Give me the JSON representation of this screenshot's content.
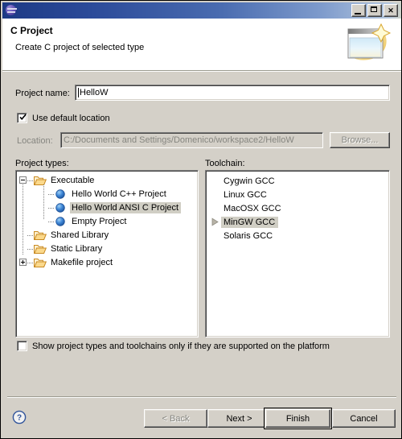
{
  "window": {
    "title": "",
    "app_icon": "eclipse-icon",
    "controls": {
      "minimize": "minimize-button",
      "maximize": "maximize-button",
      "close_label": "✕"
    }
  },
  "header": {
    "title": "C Project",
    "subtitle": "Create C project of selected type",
    "banner_icon": "new-c-project-wizard-icon"
  },
  "form": {
    "project_name_label": "Project name:",
    "project_name_value": "HelloW",
    "use_default_location_label": "Use default location",
    "use_default_location_checked": true,
    "location_label": "Location:",
    "location_value": "C:/Documents and Settings/Domenico/workspace2/HelloW",
    "location_disabled": true,
    "browse_label": "Browse...",
    "browse_disabled": true
  },
  "project_types": {
    "label": "Project types:",
    "items": [
      {
        "label": "Executable",
        "icon": "open-folder-icon",
        "level": 0,
        "expander": "minus",
        "selected": false
      },
      {
        "label": "Hello World C++ Project",
        "icon": "blue-sphere-icon",
        "level": 1,
        "expander": "none",
        "selected": false
      },
      {
        "label": "Hello World ANSI C Project",
        "icon": "blue-sphere-icon",
        "level": 1,
        "expander": "none",
        "selected": true
      },
      {
        "label": "Empty Project",
        "icon": "blue-sphere-icon",
        "level": 1,
        "expander": "none",
        "selected": false
      },
      {
        "label": "Shared Library",
        "icon": "open-folder-icon",
        "level": 0,
        "expander": "none",
        "selected": false
      },
      {
        "label": "Static Library",
        "icon": "open-folder-icon",
        "level": 0,
        "expander": "none",
        "selected": false
      },
      {
        "label": "Makefile project",
        "icon": "open-folder-icon",
        "level": 0,
        "expander": "plus",
        "selected": false
      }
    ]
  },
  "toolchain": {
    "label": "Toolchain:",
    "items": [
      {
        "label": "Cygwin GCC",
        "selected": false
      },
      {
        "label": "Linux GCC",
        "selected": false
      },
      {
        "label": "MacOSX GCC",
        "selected": false
      },
      {
        "label": "MinGW GCC",
        "selected": true
      },
      {
        "label": "Solaris GCC",
        "selected": false
      }
    ]
  },
  "options": {
    "show_supported_label": "Show project types and toolchains only if they are supported on the platform",
    "show_supported_checked": false
  },
  "footer": {
    "help_icon": "help-question-icon",
    "back_label": "< Back",
    "back_disabled": true,
    "next_label": "Next >",
    "finish_label": "Finish",
    "finish_default": true,
    "cancel_label": "Cancel"
  },
  "colors": {
    "titlebar_start": "#1d3a85",
    "titlebar_end": "#b3c6de",
    "dialog_bg": "#d4d0c8",
    "selection": "#d0cec4",
    "disabled_text": "#868680",
    "folder": "#e8a33d",
    "sphere": "#3a7fd5"
  }
}
